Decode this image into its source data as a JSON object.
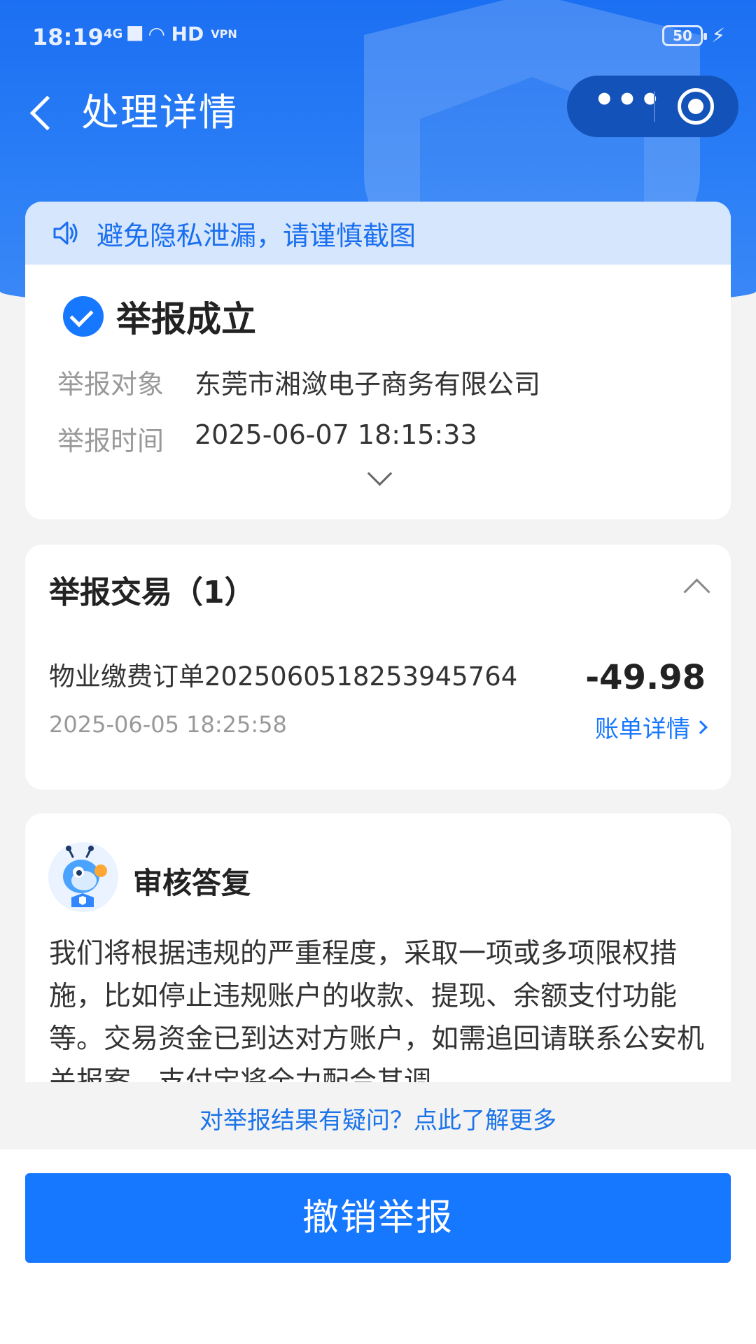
{
  "status_bar": {
    "time": "18:19",
    "network": "4G",
    "hd": "HD",
    "vpn": "VPN",
    "battery": "50"
  },
  "nav": {
    "title": "处理详情",
    "more_label": "•••"
  },
  "notice": {
    "text": "避免隐私泄漏，请谨慎截图"
  },
  "result": {
    "title": "举报成立",
    "target_label": "举报对象",
    "target_value": "东莞市湘潋电子商务有限公司",
    "time_label": "举报时间",
    "time_value": "2025-06-07 18:15:33"
  },
  "transactions": {
    "title": "举报交易（1）",
    "item": {
      "name": "物业缴费订单2025060518253945764",
      "amount": "-49.98",
      "time": "2025-06-05 18:25:58",
      "link_label": "账单详情"
    }
  },
  "review": {
    "title": "审核答复",
    "body": "我们将根据违规的严重程度，采取一项或多项限权措施，比如停止违规账户的收款、提现、余额支付功能等。交易资金已到达对方账户，如需追回请联系公安机关报案，支付宝将全力配合其调"
  },
  "faq": {
    "link": "对举报结果有疑问？点此了解更多"
  },
  "footer": {
    "cancel_label": "撤销举报"
  },
  "colors": {
    "brand": "#1677ff",
    "header_bg": "#1b6ff2",
    "notice_bg": "#d6e6fd"
  }
}
